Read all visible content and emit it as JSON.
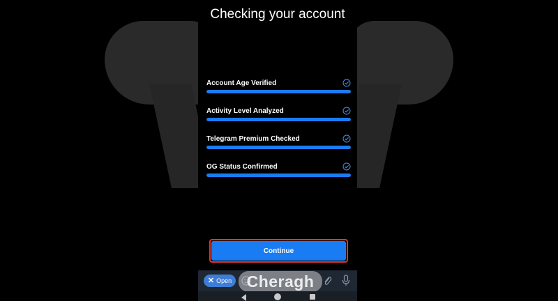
{
  "page": {
    "title": "Checking your account"
  },
  "checks": [
    {
      "label": "Account Age Verified",
      "progress": 1.0,
      "status": "checked"
    },
    {
      "label": "Activity Level Analyzed",
      "progress": 1.0,
      "status": "checked"
    },
    {
      "label": "Telegram Premium Checked",
      "progress": 1.0,
      "status": "checked"
    },
    {
      "label": "OG Status Confirmed",
      "progress": 1.0,
      "status": "checked"
    }
  ],
  "actions": {
    "continue_label": "Continue"
  },
  "bottom_bar": {
    "open_label": "Open",
    "open_icon": "close-icon",
    "message_placeholder": "",
    "icons": [
      "emoji-icon",
      "attach-icon",
      "mic-icon"
    ]
  },
  "watermark": {
    "text": "Cheragh"
  },
  "navigation": {
    "icons": [
      "back-icon",
      "home-icon",
      "recents-icon"
    ]
  },
  "colors": {
    "accent": "#1a7cf2",
    "highlight_border": "#e5332a",
    "background": "#000000",
    "text": "#ffffff",
    "bottom_bar": "#1f2733",
    "open_chip": "#3d7dd6"
  }
}
